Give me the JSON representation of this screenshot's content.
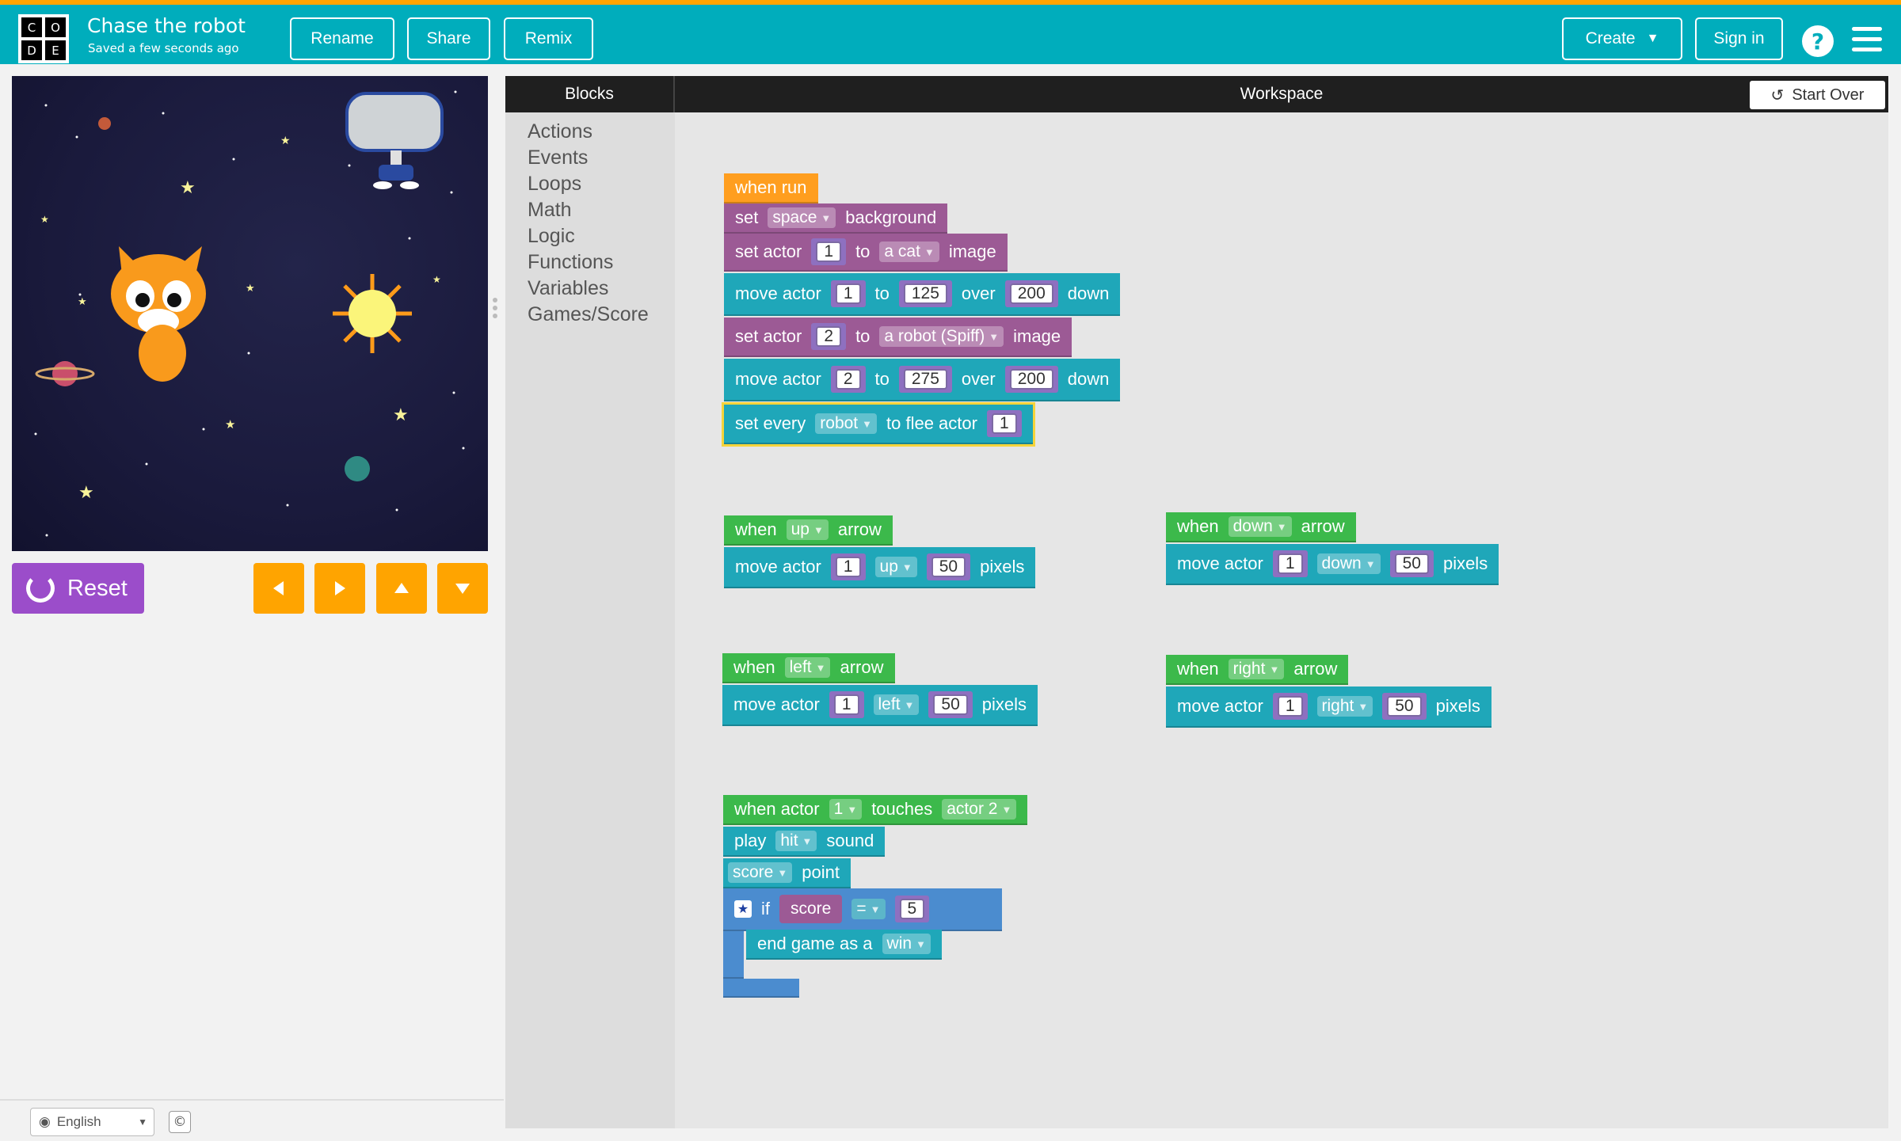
{
  "header": {
    "logo_letters": [
      "C",
      "O",
      "D",
      "E"
    ],
    "project_title": "Chase the robot",
    "saved_status": "Saved a few seconds ago",
    "rename_label": "Rename",
    "share_label": "Share",
    "remix_label": "Remix",
    "create_label": "Create",
    "signin_label": "Sign in",
    "help_label": "?"
  },
  "controls": {
    "reset_label": "Reset"
  },
  "footer": {
    "language": "English",
    "copyright": "©"
  },
  "workspace": {
    "blocks_tab": "Blocks",
    "title": "Workspace",
    "start_over": "Start Over",
    "categories": [
      "Actions",
      "Events",
      "Loops",
      "Math",
      "Logic",
      "Functions",
      "Variables",
      "Games/Score"
    ]
  },
  "blocks": {
    "when_run": "when run",
    "set_bg": {
      "pre": "set",
      "dd": "space",
      "post": "background"
    },
    "set_actor1": {
      "pre": "set actor",
      "num": "1",
      "mid": "to",
      "dd": "a cat",
      "post": "image"
    },
    "move_actor1": {
      "pre": "move actor",
      "num": "1",
      "to": "to",
      "x": "125",
      "over": "over",
      "y": "200",
      "post": "down"
    },
    "set_actor2": {
      "pre": "set actor",
      "num": "2",
      "mid": "to",
      "dd": "a robot (Spiff)",
      "post": "image"
    },
    "move_actor2": {
      "pre": "move actor",
      "num": "2",
      "to": "to",
      "x": "275",
      "over": "over",
      "y": "200",
      "post": "down"
    },
    "flee": {
      "pre": "set every",
      "dd": "robot",
      "mid": "to flee actor",
      "num": "1"
    },
    "up": {
      "when": "when",
      "dd": "up",
      "arrow": "arrow",
      "move": "move actor",
      "num": "1",
      "dir": "up",
      "px": "50",
      "pixels": "pixels"
    },
    "down": {
      "when": "when",
      "dd": "down",
      "arrow": "arrow",
      "move": "move actor",
      "num": "1",
      "dir": "down",
      "px": "50",
      "pixels": "pixels"
    },
    "left": {
      "when": "when",
      "dd": "left",
      "arrow": "arrow",
      "move": "move actor",
      "num": "1",
      "dir": "left",
      "px": "50",
      "pixels": "pixels"
    },
    "right": {
      "when": "when",
      "dd": "right",
      "arrow": "arrow",
      "move": "move actor",
      "num": "1",
      "dir": "right",
      "px": "50",
      "pixels": "pixels"
    },
    "touch": {
      "pre": "when actor",
      "num": "1",
      "mid": "touches",
      "dd": "actor 2"
    },
    "play": {
      "pre": "play",
      "dd": "hit",
      "post": "sound"
    },
    "score": {
      "dd": "score",
      "post": "point"
    },
    "if": {
      "if": "if",
      "var": "score",
      "op": "=",
      "num": "5"
    },
    "end": {
      "pre": "end game as a",
      "dd": "win"
    }
  },
  "colors": {
    "header": "#00adbc",
    "events": "#ff9e1f",
    "actions_purple": "#9c5a95",
    "actions_teal": "#1fa7b9",
    "handlers": "#3cb94b",
    "reset": "#9b4dca",
    "arrows": "#ffa400"
  },
  "icons": [
    "undo-icon",
    "globe-icon",
    "star-icon",
    "caret-down-icon"
  ]
}
